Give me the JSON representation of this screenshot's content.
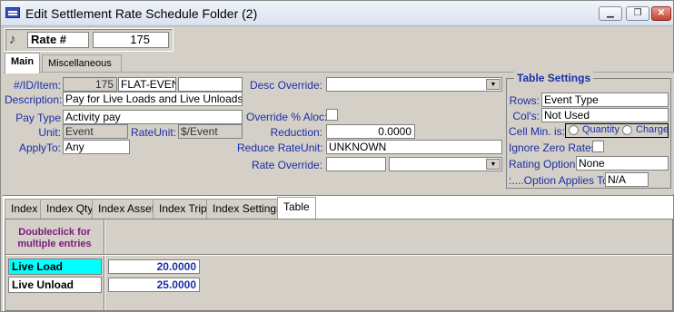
{
  "window": {
    "title": "Edit Settlement Rate Schedule Folder (2)",
    "minimize_glyph": "▁",
    "restore_glyph": "❐",
    "close_glyph": "✕"
  },
  "rate_bar": {
    "label": "Rate #",
    "value": "175",
    "icon": "music-note-icon"
  },
  "main_tabs": [
    {
      "label": "Main"
    },
    {
      "label": "Miscellaneous"
    }
  ],
  "form": {
    "id_item_label": "#/ID/Item:",
    "id_number": "175",
    "id_code": "FLAT-EVEN`",
    "id_item": "",
    "description_label": "Description:",
    "description": "Pay for Live Loads and Live Unloads",
    "pay_type_label": "Pay Type",
    "pay_type": "Activity pay",
    "unit_label": "Unit:",
    "unit": "Event",
    "rate_unit_label": "RateUnit:",
    "rate_unit": "$/Event",
    "apply_to_label": "ApplyTo:",
    "apply_to": "Any",
    "desc_override_label": "Desc Override:",
    "desc_override": "",
    "override_aloc_label": "Override % Aloc:",
    "reduction_label": "Reduction:",
    "reduction": "0.0000",
    "reduce_rate_unit_label": "Reduce RateUnit:",
    "reduce_rate_unit": "UNKNOWN",
    "rate_override_label": "Rate Override:",
    "rate_override": "",
    "rate_override_unit": ""
  },
  "table_settings": {
    "legend": "Table Settings",
    "rows_label": "Rows:",
    "rows": "Event Type",
    "cols_label": "Col's:",
    "cols": "Not Used",
    "cell_min_label": "Cell Min. is:",
    "cell_min_options": [
      "Quantity",
      "Charge"
    ],
    "ignore_zero_label": "Ignore Zero Rates",
    "rating_option_label": "Rating Option:",
    "rating_option": "None",
    "option_applies_label": ":....Option Applies To:",
    "option_applies": "N/A"
  },
  "bottom_tabs": [
    {
      "label": "Index"
    },
    {
      "label": "Index Qty"
    },
    {
      "label": "Index Asset"
    },
    {
      "label": "Index Trip"
    },
    {
      "label": "Index Settings"
    },
    {
      "label": "Table"
    }
  ],
  "grid": {
    "header_line1": "Doubleclick for",
    "header_line2": "multiple entries",
    "rows": [
      {
        "label": "Live Load",
        "value": "20.0000"
      },
      {
        "label": "Live Unload",
        "value": "25.0000"
      }
    ]
  },
  "colors": {
    "label_blue": "#1a2fa8",
    "selected_row": "#00ffff",
    "header_purple": "#7a1a7a"
  }
}
